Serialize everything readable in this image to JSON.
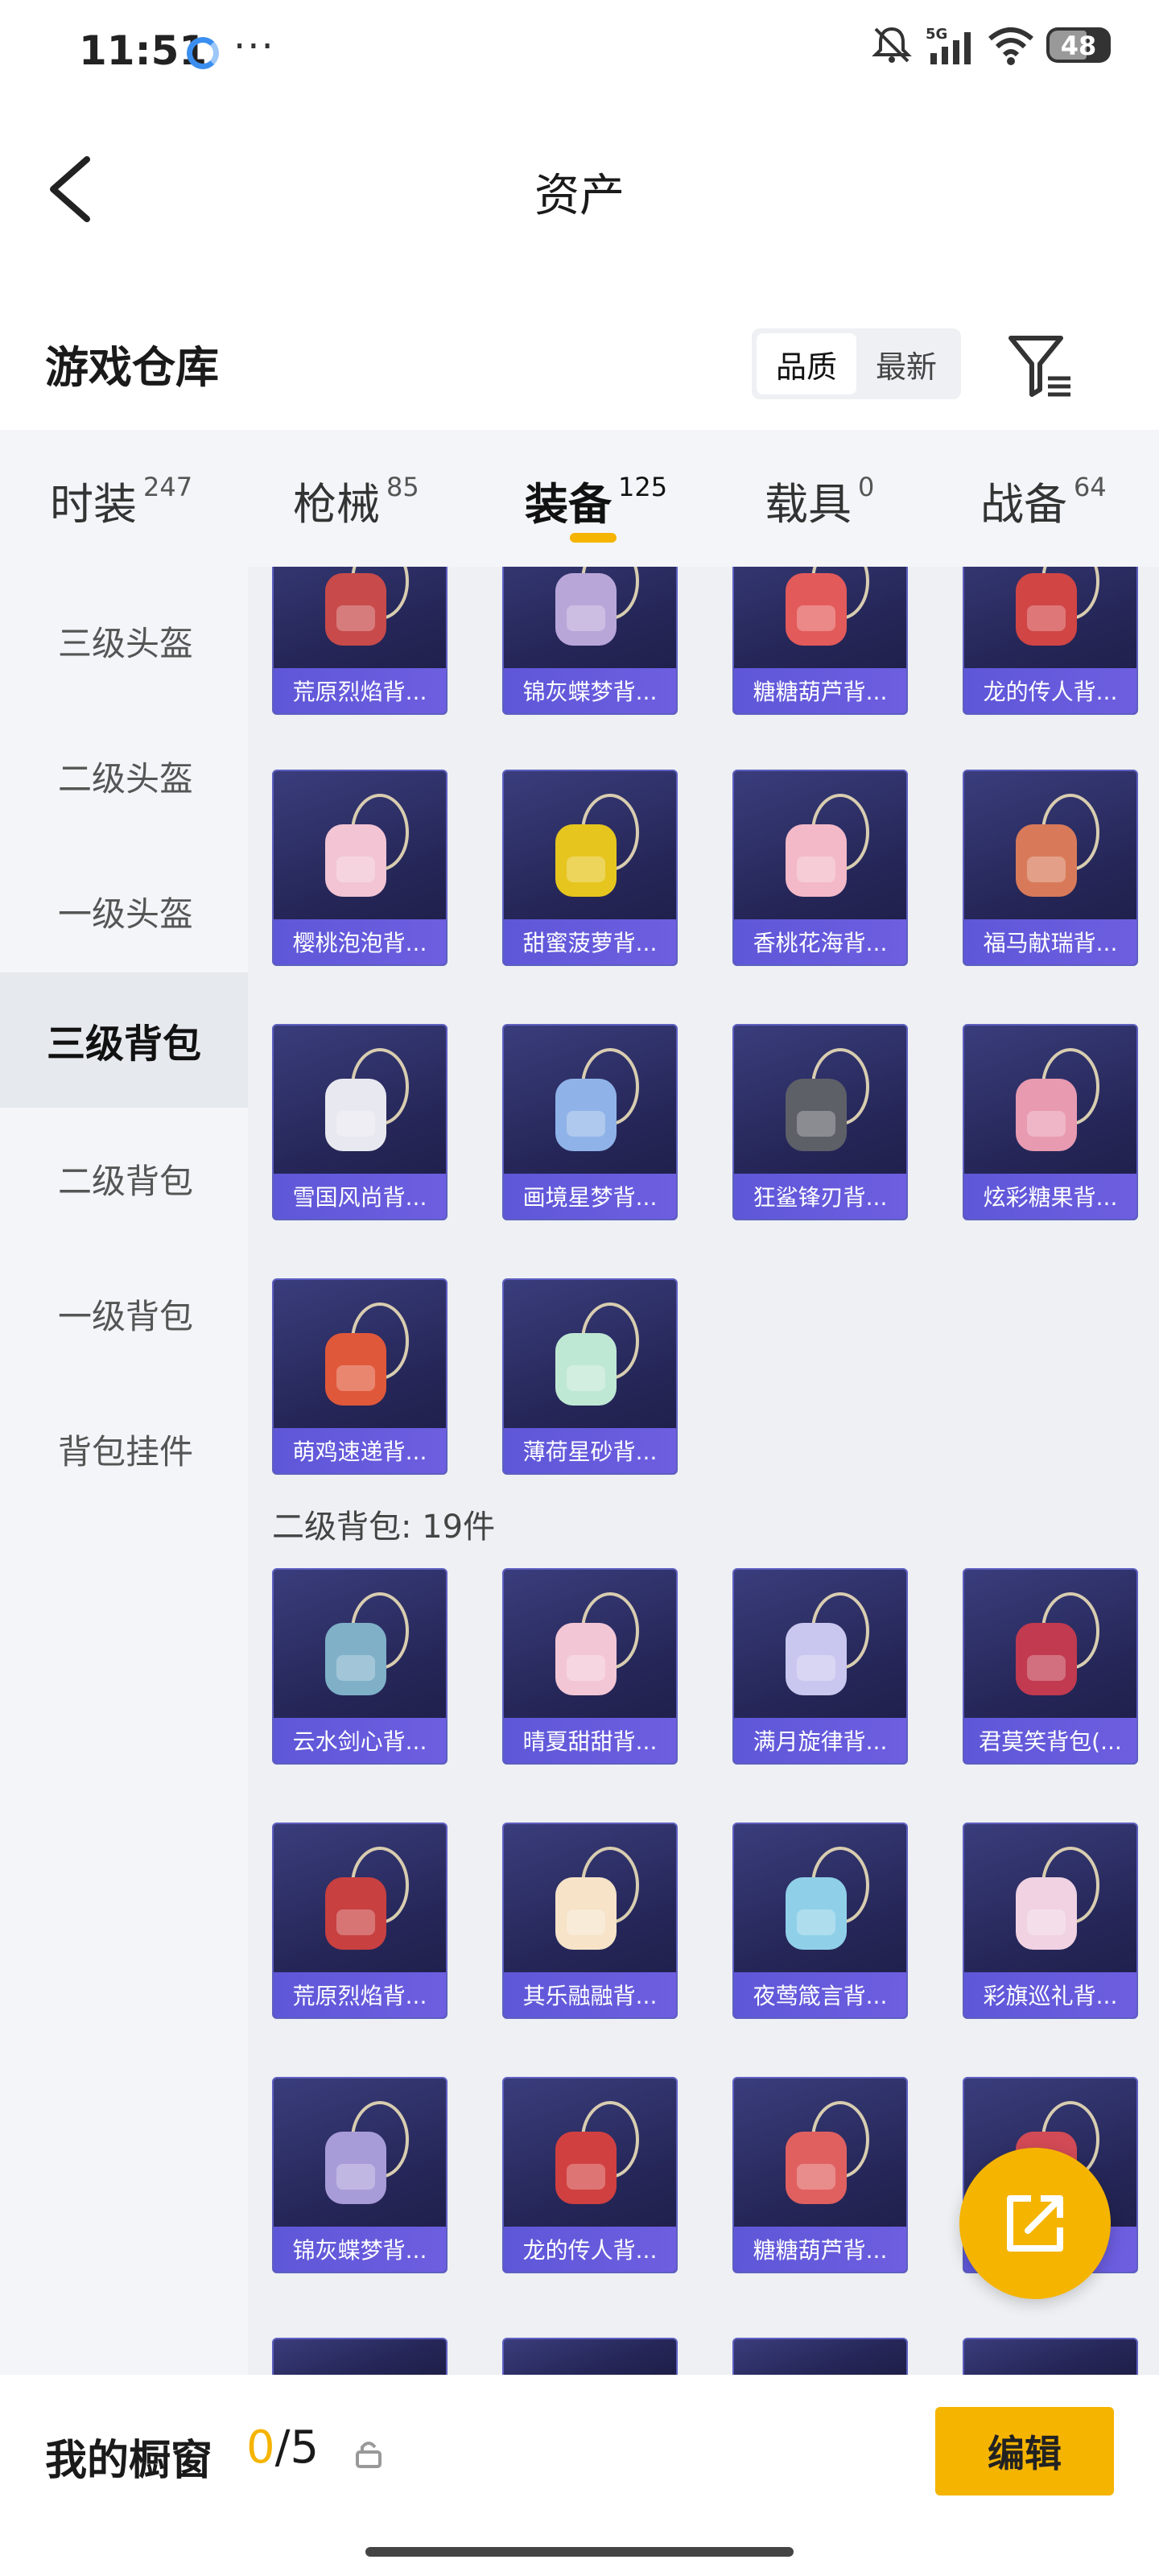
{
  "status_bar": {
    "time": "11:51",
    "dots": "···",
    "network": "5G",
    "battery": "48",
    "icons": [
      "mute-bell-icon",
      "signal-icon",
      "wifi-icon",
      "battery-icon"
    ]
  },
  "header": {
    "title": "资产",
    "back_icon": "back-arrow-icon"
  },
  "warehouse": {
    "title": "游戏仓库",
    "sort_options": [
      "品质",
      "最新"
    ],
    "active_sort": "品质",
    "filter_icon": "filter-icon"
  },
  "tabs": [
    {
      "label": "时装",
      "count": "247"
    },
    {
      "label": "枪械",
      "count": "85"
    },
    {
      "label": "装备",
      "count": "125"
    },
    {
      "label": "载具",
      "count": "0"
    },
    {
      "label": "战备",
      "count": "64"
    }
  ],
  "active_tab": "装备",
  "sidebar": [
    {
      "label": "三级头盔"
    },
    {
      "label": "二级头盔"
    },
    {
      "label": "一级头盔"
    },
    {
      "label": "三级背包"
    },
    {
      "label": "二级背包"
    },
    {
      "label": "一级背包"
    },
    {
      "label": "背包挂件"
    }
  ],
  "active_sidebar": "三级背包",
  "level3_items": [
    "荒原烈焰背...",
    "锦灰蝶梦背...",
    "糖糖葫芦背...",
    "龙的传人背...",
    "樱桃泡泡背...",
    "甜蜜菠萝背...",
    "香桃花海背...",
    "福马献瑞背...",
    "雪国风尚背...",
    "画境星梦背...",
    "狂鲨锋刃背...",
    "炫彩糖果背...",
    "萌鸡速递背...",
    "薄荷星砂背..."
  ],
  "level2_section": {
    "label": "二级背包: 19件"
  },
  "level2_items": [
    "云水剑心背...",
    "晴夏甜甜背...",
    "满月旋律背...",
    "君莫笑背包(...",
    "荒原烈焰背...",
    "其乐融融背...",
    "夜莺箴言背...",
    "彩旗巡礼背...",
    "锦灰蝶梦背...",
    "龙的传人背...",
    "糖糖葫芦背...",
    ""
  ],
  "bottom": {
    "showcase_label": "我的橱窗",
    "showcase_current": "0",
    "showcase_total": "/5",
    "edit_label": "编辑"
  },
  "colors": {
    "accent": "#f5b400",
    "card_bg": "#2a2b60",
    "card_label_bg": "#6058d8"
  }
}
